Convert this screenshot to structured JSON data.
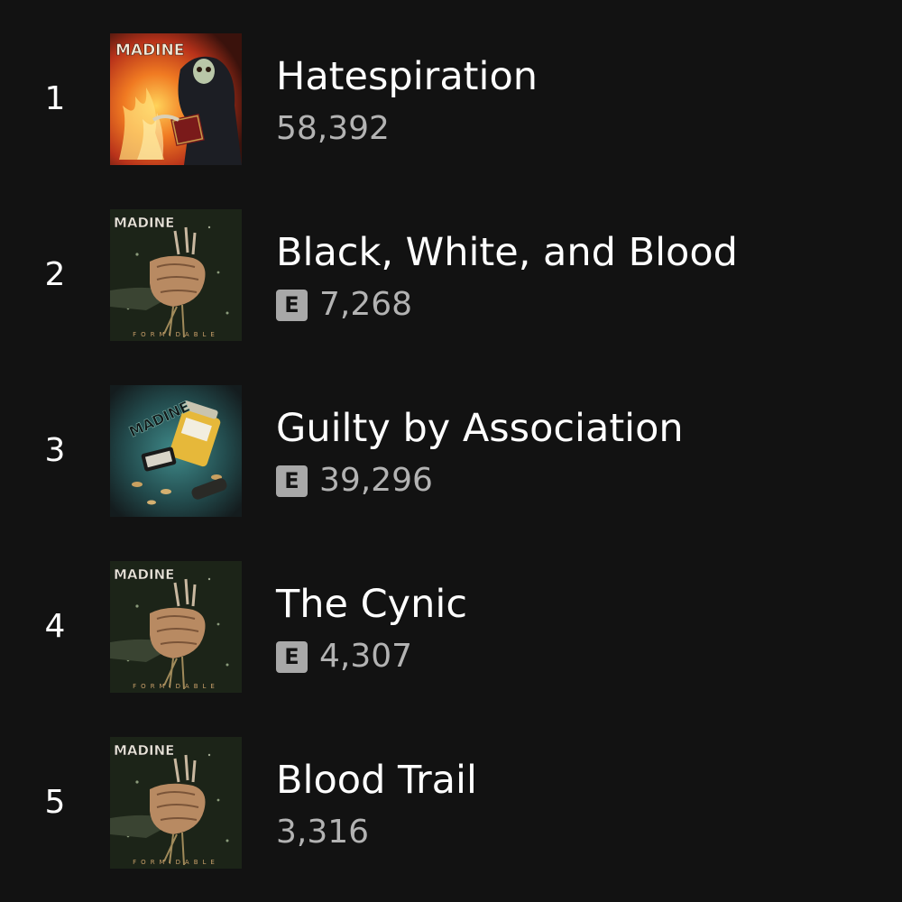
{
  "tracks": [
    {
      "rank": "1",
      "title": "Hatespiration",
      "plays": "58,392",
      "explicit": false,
      "art": "fire-reaper-cover",
      "logo": "MADINE"
    },
    {
      "rank": "2",
      "title": "Black, White, and Blood",
      "plays": "7,268",
      "explicit": true,
      "art": "formidable-cover",
      "logo": "MADINE",
      "caption": "FORMIDABLE"
    },
    {
      "rank": "3",
      "title": "Guilty by Association",
      "plays": "39,296",
      "explicit": true,
      "art": "pill-bottle-cover",
      "logo": "MADINE"
    },
    {
      "rank": "4",
      "title": "The Cynic",
      "plays": "4,307",
      "explicit": true,
      "art": "formidable-cover",
      "logo": "MADINE",
      "caption": "FORMIDABLE"
    },
    {
      "rank": "5",
      "title": "Blood Trail",
      "plays": "3,316",
      "explicit": false,
      "art": "formidable-cover",
      "logo": "MADINE",
      "caption": "FORMIDABLE"
    }
  ],
  "explicit_label": "E",
  "colors": {
    "background": "#121212",
    "title": "#ffffff",
    "plays": "#b3b3b3",
    "badge": "#a8a8a8"
  }
}
